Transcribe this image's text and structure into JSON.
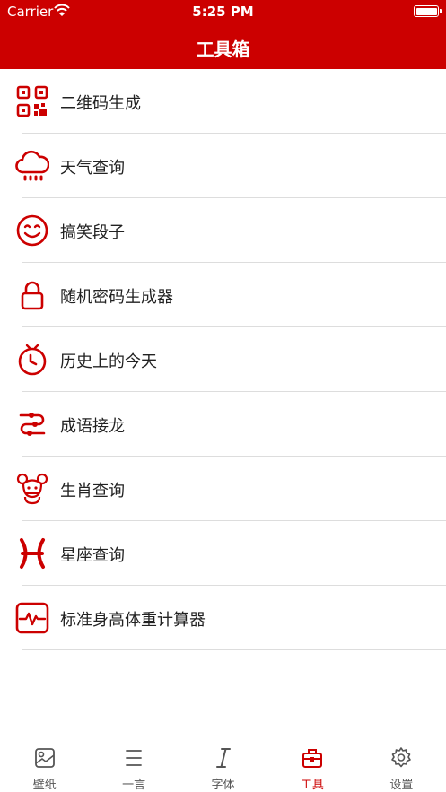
{
  "status_bar": {
    "carrier": "Carrier",
    "time": "5:25 PM"
  },
  "nav": {
    "title": "工具箱"
  },
  "colors": {
    "brand": "#cc0000",
    "text": "#222222",
    "tab_inactive": "#555555"
  },
  "tools": [
    {
      "label": "二维码生成",
      "icon": "qr-code-icon"
    },
    {
      "label": "天气查询",
      "icon": "cloud-rain-icon"
    },
    {
      "label": "搞笑段子",
      "icon": "smiley-icon"
    },
    {
      "label": "随机密码生成器",
      "icon": "lock-icon"
    },
    {
      "label": "历史上的今天",
      "icon": "clock-icon"
    },
    {
      "label": "成语接龙",
      "icon": "route-icon"
    },
    {
      "label": "生肖查询",
      "icon": "mouse-zodiac-icon"
    },
    {
      "label": "星座查询",
      "icon": "pisces-icon"
    },
    {
      "label": "标准身高体重计算器",
      "icon": "pulse-monitor-icon"
    }
  ],
  "tabs": [
    {
      "label": "壁纸",
      "icon": "wallpaper-icon"
    },
    {
      "label": "一言",
      "icon": "sentence-icon"
    },
    {
      "label": "字体",
      "icon": "font-italic-icon"
    },
    {
      "label": "工具",
      "icon": "toolbox-icon",
      "active": true
    },
    {
      "label": "设置",
      "icon": "gear-icon"
    }
  ]
}
